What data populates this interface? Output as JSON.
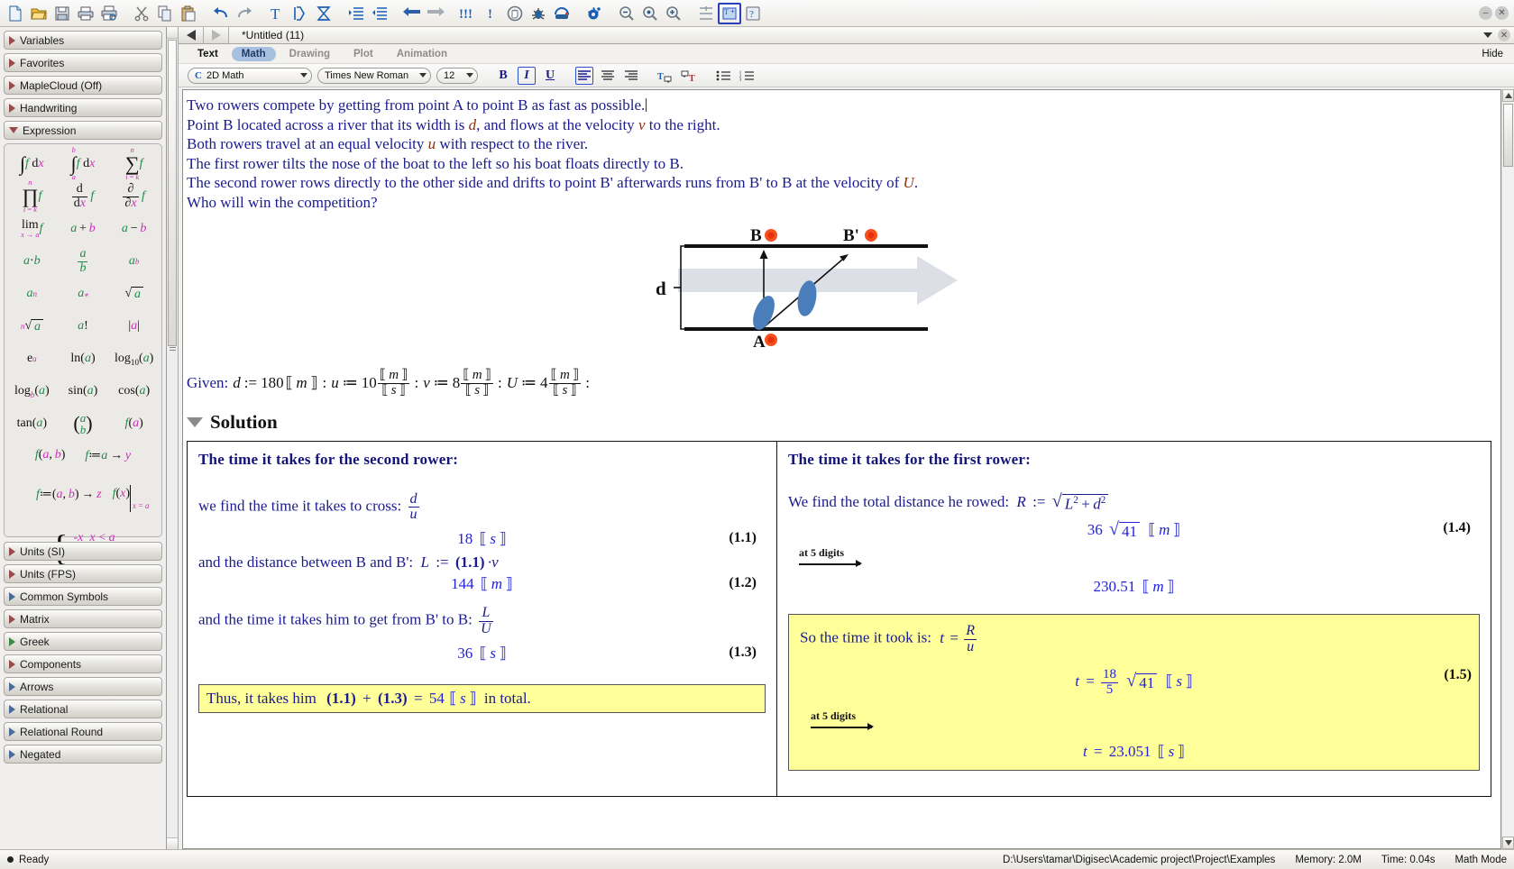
{
  "toolbar": {
    "buttons": [
      {
        "name": "new-document-icon",
        "title": "New"
      },
      {
        "name": "open-folder-icon",
        "title": "Open"
      },
      {
        "name": "save-icon",
        "title": "Save"
      },
      {
        "name": "print-icon",
        "title": "Print"
      },
      {
        "name": "print-preview-icon",
        "title": "Print Preview"
      },
      {
        "name": "cut-scissors-icon",
        "title": "Cut"
      },
      {
        "name": "copy-icon",
        "title": "Copy"
      },
      {
        "name": "paste-icon",
        "title": "Paste"
      },
      {
        "name": "undo-icon",
        "title": "Undo"
      },
      {
        "name": "redo-icon",
        "title": "Redo"
      },
      {
        "name": "text-mode-icon",
        "title": "Text"
      },
      {
        "name": "prompt-mode-icon",
        "title": "Math Input"
      },
      {
        "name": "hourglass-icon",
        "title": "Execute"
      },
      {
        "name": "indent-in-icon",
        "title": "Indent"
      },
      {
        "name": "indent-out-icon",
        "title": "Outdent"
      },
      {
        "name": "arrow-left-icon",
        "title": "Back"
      },
      {
        "name": "arrow-right-icon",
        "title": "Forward"
      },
      {
        "name": "execute-all-icon",
        "title": "Execute All"
      },
      {
        "name": "interrupt-icon",
        "title": "Interrupt"
      },
      {
        "name": "pan-hand-icon",
        "title": "Pan"
      },
      {
        "name": "debug-icon",
        "title": "Debug"
      },
      {
        "name": "restart-icon",
        "title": "Restart Server"
      },
      {
        "name": "settings-gear-icon",
        "title": "Options"
      },
      {
        "name": "zoom-out-icon",
        "title": "Zoom Out"
      },
      {
        "name": "zoom-reset-icon",
        "title": "Zoom 100%"
      },
      {
        "name": "zoom-in-icon",
        "title": "Zoom In"
      },
      {
        "name": "table-icon",
        "title": "Insert Table"
      },
      {
        "name": "insert-plot-icon",
        "title": "Insert Plot"
      },
      {
        "name": "help-icon",
        "title": "Help"
      }
    ]
  },
  "window": {
    "minimize": "–",
    "close": "✕"
  },
  "palette": {
    "sections_top": [
      {
        "label": "Variables",
        "state": "collapsed",
        "tri": "red"
      },
      {
        "label": "Favorites",
        "state": "collapsed",
        "tri": "red"
      },
      {
        "label": "MapleCloud (Off)",
        "state": "collapsed",
        "tri": "red"
      },
      {
        "label": "Handwriting",
        "state": "collapsed",
        "tri": "red"
      },
      {
        "label": "Expression",
        "state": "expanded",
        "tri": "red"
      }
    ],
    "sections_bottom": [
      {
        "label": "Units (SI)",
        "tri": "red"
      },
      {
        "label": "Units (FPS)",
        "tri": "red"
      },
      {
        "label": "Common Symbols",
        "tri": "blue"
      },
      {
        "label": "Matrix",
        "tri": "red"
      },
      {
        "label": "Greek",
        "tri": "green"
      },
      {
        "label": "Components",
        "tri": "red"
      },
      {
        "label": "Arrows",
        "tri": "blue"
      },
      {
        "label": "Relational",
        "tri": "blue"
      },
      {
        "label": "Relational Round",
        "tri": "blue"
      },
      {
        "label": "Negated",
        "tri": "blue"
      }
    ]
  },
  "doctab": {
    "title": "*Untitled (11)",
    "back_arrow": "back-arrow",
    "forward_arrow": "forward-arrow"
  },
  "context": {
    "tabs": [
      {
        "label": "Text",
        "active": false
      },
      {
        "label": "Math",
        "active": true
      },
      {
        "label": "Drawing",
        "active": false
      },
      {
        "label": "Plot",
        "active": false
      },
      {
        "label": "Animation",
        "active": false
      }
    ],
    "hide_label": "Hide"
  },
  "format": {
    "mode": "2D Math",
    "mode_marker": "C",
    "font": "Times New Roman",
    "size": "12",
    "bold": "B",
    "italic": "I",
    "underline": "U",
    "align_left": "align-left",
    "align_center": "align-center",
    "align_right": "align-right"
  },
  "document": {
    "problem_lines": [
      "Two rowers compete by getting from point A to point B as fast as possible.",
      "Point B located across a river that its width is d, and flows at the velocity v to the right.",
      "Both rowers travel at an equal velocity u with respect to the river.",
      "The first rower tilts the nose of the boat to the left so his boat floats directly to B.",
      "The second rower rows directly to the other side and drifts to point B' afterwards runs from B' to B at the velocity of U.",
      "Who will win the competition?"
    ],
    "diagram": {
      "label_B": "B",
      "label_Bprime": "B'",
      "label_A": "A",
      "label_d": "d",
      "river_color": "#dcdfe6",
      "boat_color": "#4a7ebb",
      "point_color": "#f4511e"
    },
    "given": {
      "label": "Given:",
      "d_var": "d",
      "d_assign": ":=",
      "d_value": "180",
      "d_unit": "m",
      "u_var": "u",
      "u_value": "10",
      "u_unit_num": "m",
      "u_unit_den": "s",
      "v_var": "v",
      "v_value": "8",
      "v_unit_num": "m",
      "v_unit_den": "s",
      "U_var": "U",
      "U_value": "4",
      "U_unit_num": "m",
      "U_unit_den": "s",
      "sep": ":"
    },
    "solution_title": "Solution",
    "left_box": {
      "heading": "The time it takes for the second rower:",
      "line1": "we find the time it takes to cross:",
      "line1_frac_num": "d",
      "line1_frac_den": "u",
      "result1": "18",
      "result1_unit": "s",
      "label1": "(1.1)",
      "line2": "and the distance between B and B': L := (1.1)·v",
      "line2_pre": "and the distance between B and B':",
      "line2_var": "L",
      "line2_assign": ":=",
      "line2_ref": "(1.1)",
      "line2_mul": "·v",
      "result2": "144",
      "result2_unit": "m",
      "label2": "(1.2)",
      "line3": "and the time it takes him to get from B' to B:",
      "line3_frac_num": "L",
      "line3_frac_den": "U",
      "result3": "36",
      "result3_unit": "s",
      "label3": "(1.3)",
      "conclusion_pre": "Thus, it takes him",
      "conclusion_ref1": "(1.1)",
      "conclusion_plus": "+",
      "conclusion_ref2": "(1.3)",
      "conclusion_eq": "=",
      "conclusion_value": "54",
      "conclusion_unit": "s",
      "conclusion_post": "in total."
    },
    "right_box": {
      "heading": "The time it takes for the first rower:",
      "line1_pre": "We find the total distance he rowed:",
      "line1_var": "R",
      "line1_assign": ":=",
      "line1_expr_L": "L",
      "line1_expr_Lexp": "2",
      "line1_plus": "+",
      "line1_expr_d": "d",
      "line1_expr_dexp": "2",
      "result1_coef": "36",
      "result1_root": "41",
      "result1_unit": "m",
      "label1": "(1.4)",
      "arrow_label": "at 5 digits",
      "result2": "230.51",
      "result2_unit": "m",
      "yellow_line": "So the time it took is:",
      "yellow_t": "t",
      "yellow_eq": "=",
      "yellow_frac_num": "R",
      "yellow_frac_den": "u",
      "res_t": "t",
      "res_eq": "=",
      "res_frac_num": "18",
      "res_frac_den": "5",
      "res_root": "41",
      "res_unit": "s",
      "label2": "(1.5)",
      "arrow_label2": "at 5 digits",
      "final_t": "t",
      "final_eq": "=",
      "final_value": "23.051",
      "final_unit": "s"
    }
  },
  "status": {
    "ready": "Ready",
    "path": "D:\\Users\\tamar\\Digisec\\Academic project\\Project\\Examples",
    "memory": "Memory: 2.0M",
    "time": "Time: 0.04s",
    "mode": "Math Mode"
  }
}
